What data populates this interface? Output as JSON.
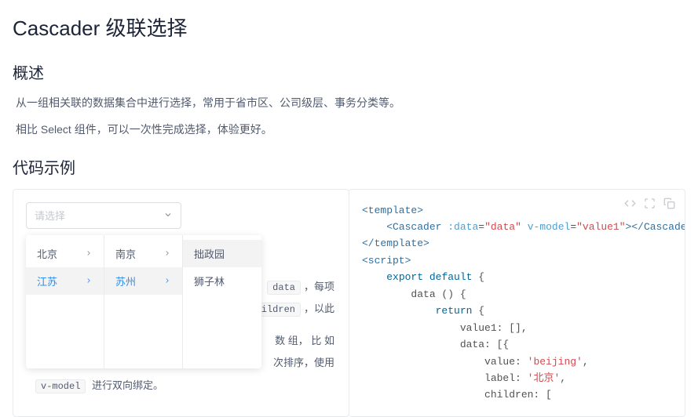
{
  "page": {
    "title": "Cascader 级联选择",
    "overview_heading": "概述",
    "overview_p1": "从一组相关联的数据集合中进行选择，常用于省市区、公司级层、事务分类等。",
    "overview_p2": "相比 Select 组件，可以一次性完成选择，体验更好。",
    "examples_heading": "代码示例"
  },
  "cascader": {
    "placeholder": "请选择",
    "columns": [
      {
        "items": [
          {
            "label": "北京",
            "has_children": true,
            "active": false
          },
          {
            "label": "江苏",
            "has_children": true,
            "active": true
          }
        ]
      },
      {
        "items": [
          {
            "label": "南京",
            "has_children": true,
            "active": false
          },
          {
            "label": "苏州",
            "has_children": true,
            "active": true
          }
        ]
      },
      {
        "items": [
          {
            "label": "拙政园",
            "has_children": false,
            "active": false,
            "hover": true
          },
          {
            "label": "狮子林",
            "has_children": false,
            "active": false
          }
        ]
      }
    ]
  },
  "desc": {
    "chip1": "data",
    "tail1": "，每项",
    "chip2": "ildren",
    "tail2": "，以此",
    "line3a": "数 组， 比 如",
    "line3b": "次排序，使用",
    "line3c": "进行双向绑定。",
    "vmodel_chip": "v-model"
  },
  "code": {
    "lines": [
      {
        "type": "tag-open",
        "name": "template"
      },
      {
        "type": "element",
        "indent": 1,
        "name": "Cascader",
        "attrs": [
          {
            "k": ":data",
            "v": "data"
          },
          {
            "k": "v-model",
            "v": "value1"
          }
        ],
        "self": true,
        "truncated": true
      },
      {
        "type": "tag-close",
        "name": "template"
      },
      {
        "type": "tag-open",
        "name": "script"
      },
      {
        "type": "js",
        "indent": 1,
        "text": "export default {"
      },
      {
        "type": "js",
        "indent": 2,
        "text": "data () {"
      },
      {
        "type": "js",
        "indent": 3,
        "text": "return {"
      },
      {
        "type": "js",
        "indent": 4,
        "text": "value1: [],"
      },
      {
        "type": "js",
        "indent": 4,
        "text": "data: [{"
      },
      {
        "type": "js-kv",
        "indent": 5,
        "key": "value",
        "val": "'beijing'",
        "comma": true
      },
      {
        "type": "js-kv",
        "indent": 5,
        "key": "label",
        "val": "'北京'",
        "comma": true
      },
      {
        "type": "js",
        "indent": 5,
        "text": "children: ["
      }
    ]
  },
  "toolbar_icons": [
    "code-icon",
    "expand-icon",
    "copy-icon"
  ]
}
